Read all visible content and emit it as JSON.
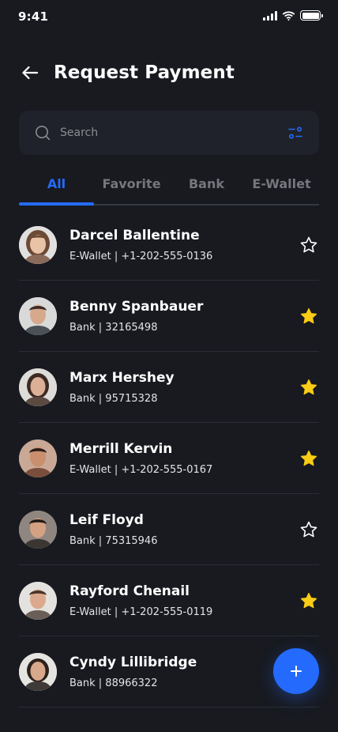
{
  "status_bar": {
    "time": "9:41"
  },
  "header": {
    "title": "Request Payment"
  },
  "search": {
    "placeholder": "Search"
  },
  "tabs": [
    {
      "label": "All",
      "active": true
    },
    {
      "label": "Favorite",
      "active": false
    },
    {
      "label": "Bank",
      "active": false
    },
    {
      "label": "E-Wallet",
      "active": false
    }
  ],
  "contacts": [
    {
      "name": "Darcel Ballentine",
      "detail": "E-Wallet | +1-202-555-0136",
      "favorite": false
    },
    {
      "name": "Benny Spanbauer",
      "detail": "Bank | 32165498",
      "favorite": true
    },
    {
      "name": "Marx Hershey",
      "detail": "Bank | 95715328",
      "favorite": true
    },
    {
      "name": "Merrill Kervin",
      "detail": "E-Wallet | +1-202-555-0167",
      "favorite": true
    },
    {
      "name": "Leif Floyd",
      "detail": "Bank | 75315946",
      "favorite": false
    },
    {
      "name": "Rayford Chenail",
      "detail": "E-Wallet | +1-202-555-0119",
      "favorite": true
    },
    {
      "name": "Cyndy Lillibridge",
      "detail": "Bank | 88966322",
      "favorite": false
    }
  ],
  "colors": {
    "background": "#181a20",
    "surface": "#1f222a",
    "accent": "#246bfd",
    "star_favorite": "#facc15",
    "muted_text": "#75777d"
  },
  "icons": {
    "back": "arrow-left-icon",
    "search": "search-icon",
    "filter": "filter-icon",
    "star": "star-icon",
    "add": "plus-icon"
  }
}
